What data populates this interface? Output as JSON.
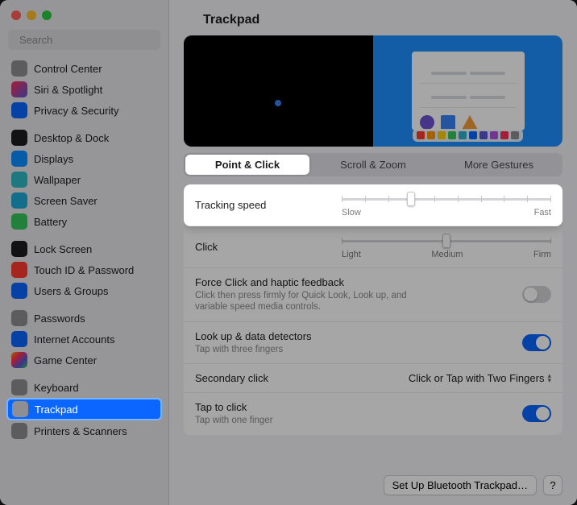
{
  "traffic": {
    "colors": [
      "#ff5f57",
      "#febc2e",
      "#28c840"
    ]
  },
  "search": {
    "placeholder": "Search"
  },
  "sidebar": {
    "groups": [
      [
        {
          "label": "Control Center",
          "icon_bg": "#8e8e93",
          "icon_name": "control-center-icon"
        },
        {
          "label": "Siri & Spotlight",
          "icon_bg": "linear-gradient(135deg,#ff2d55,#5856d6)",
          "icon_name": "siri-icon"
        },
        {
          "label": "Privacy & Security",
          "icon_bg": "#0a66ff",
          "icon_name": "hand-icon"
        }
      ],
      [
        {
          "label": "Desktop & Dock",
          "icon_bg": "#1d1d1f",
          "icon_name": "desktop-icon"
        },
        {
          "label": "Displays",
          "icon_bg": "#0a8eff",
          "icon_name": "displays-icon"
        },
        {
          "label": "Wallpaper",
          "icon_bg": "#2fb8c5",
          "icon_name": "wallpaper-icon"
        },
        {
          "label": "Screen Saver",
          "icon_bg": "#1eaad8",
          "icon_name": "screensaver-icon"
        },
        {
          "label": "Battery",
          "icon_bg": "#34c759",
          "icon_name": "battery-icon"
        }
      ],
      [
        {
          "label": "Lock Screen",
          "icon_bg": "#1d1d1f",
          "icon_name": "lock-icon"
        },
        {
          "label": "Touch ID & Password",
          "icon_bg": "#ff3b30",
          "icon_name": "fingerprint-icon"
        },
        {
          "label": "Users & Groups",
          "icon_bg": "#0a66ff",
          "icon_name": "users-icon"
        }
      ],
      [
        {
          "label": "Passwords",
          "icon_bg": "#8e8e93",
          "icon_name": "key-icon"
        },
        {
          "label": "Internet Accounts",
          "icon_bg": "#0a66ff",
          "icon_name": "at-icon"
        },
        {
          "label": "Game Center",
          "icon_bg": "linear-gradient(135deg,#ff9500,#ff2d55,#5856d6,#34c759)",
          "icon_name": "gamecenter-icon"
        }
      ],
      [
        {
          "label": "Keyboard",
          "icon_bg": "#8e8e93",
          "icon_name": "keyboard-icon"
        },
        {
          "label": "Trackpad",
          "icon_bg": "#8e8e93",
          "icon_name": "trackpad-icon",
          "selected": true
        },
        {
          "label": "Printers & Scanners",
          "icon_bg": "#8e8e93",
          "icon_name": "printer-icon"
        }
      ]
    ]
  },
  "main": {
    "title": "Trackpad",
    "tabs": [
      "Point & Click",
      "Scroll & Zoom",
      "More Gestures"
    ],
    "active_tab": 0,
    "rows": {
      "tracking": {
        "label": "Tracking speed",
        "min_label": "Slow",
        "max_label": "Fast",
        "ticks": 10,
        "value_percent": 33
      },
      "click": {
        "label": "Click",
        "min_label": "Light",
        "mid_label": "Medium",
        "max_label": "Firm",
        "ticks": 3,
        "value_percent": 50
      },
      "force": {
        "label": "Force Click and haptic feedback",
        "sub": "Click then press firmly for Quick Look, Look up, and variable speed media controls.",
        "on": false
      },
      "lookup": {
        "label": "Look up & data detectors",
        "sub": "Tap with three fingers",
        "on": true
      },
      "secondary": {
        "label": "Secondary click",
        "value": "Click or Tap with Two Fingers"
      },
      "tap": {
        "label": "Tap to click",
        "sub": "Tap with one finger",
        "on": true
      }
    },
    "footer": {
      "setup": "Set Up Bluetooth Trackpad…",
      "help": "?"
    }
  },
  "palette": [
    "#ff3b30",
    "#ff9500",
    "#ffcc00",
    "#34c759",
    "#30b0c7",
    "#0a66ff",
    "#5856d6",
    "#af52de",
    "#ff2d55",
    "#8e8e93"
  ]
}
